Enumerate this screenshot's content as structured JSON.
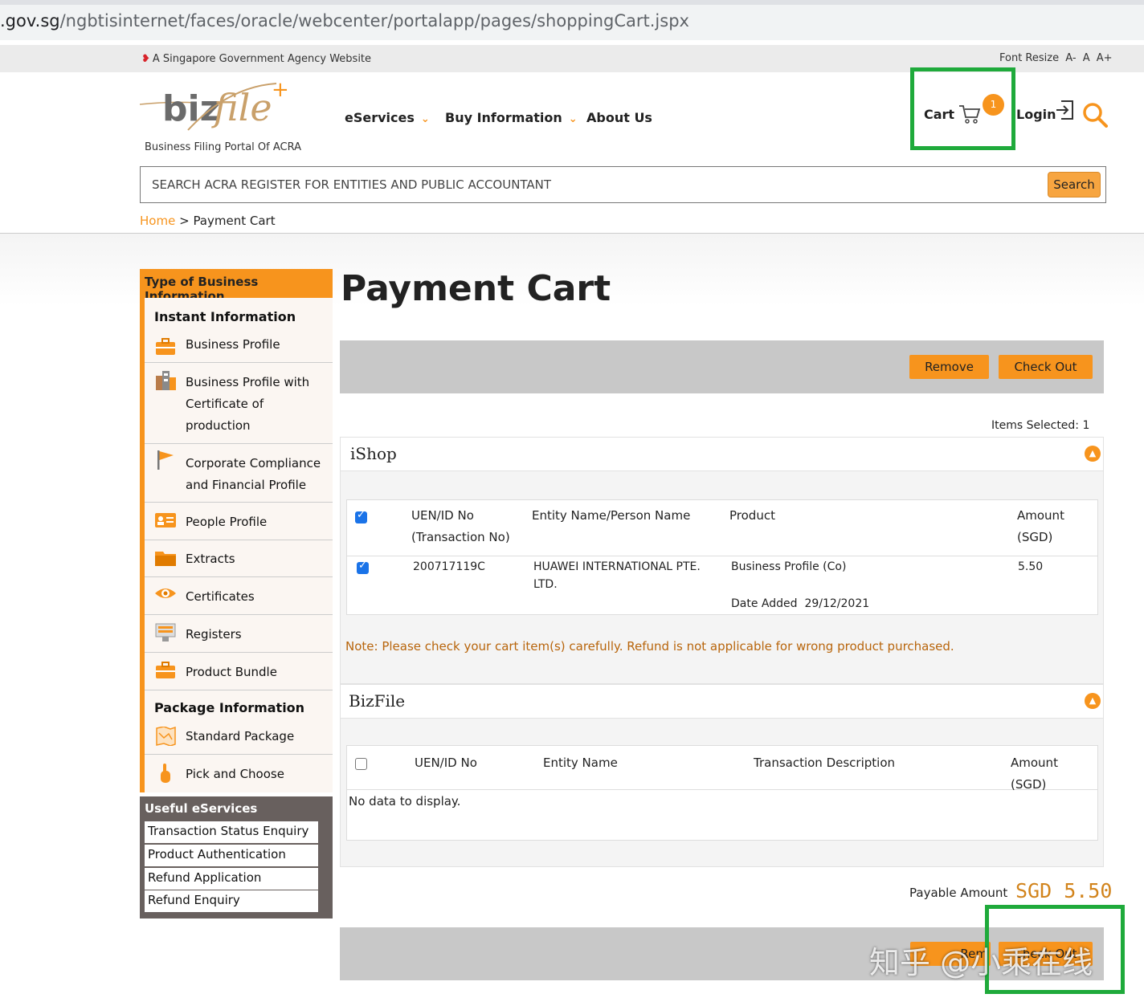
{
  "browser": {
    "url_domain": ".gov.sg",
    "url_path": "/ngbtisinternet/faces/oracle/webcenter/portalapp/pages/shoppingCart.jspx"
  },
  "gov_strip": {
    "text": "A Singapore Government Agency Website",
    "font_resize_label": "Font Resize",
    "font_sizes": [
      "A-",
      "A",
      "A+"
    ]
  },
  "header": {
    "logo_tagline": "Business Filing Portal Of ACRA",
    "nav": [
      {
        "label": "eServices",
        "dropdown": true
      },
      {
        "label": "Buy Information",
        "dropdown": true
      },
      {
        "label": "About Us",
        "dropdown": false
      }
    ],
    "cart_label": "Cart",
    "cart_count": "1",
    "login_label": "Login",
    "accent_color": "#f7941d"
  },
  "search": {
    "placeholder": "SEARCH ACRA REGISTER FOR ENTITIES AND PUBLIC ACCOUNTANT",
    "button_label": "Search"
  },
  "breadcrumb": {
    "home": "Home",
    "separator": ">",
    "current": "Payment Cart"
  },
  "sidebar": {
    "title": "Type of Business Information",
    "instant_heading": "Instant Information",
    "items": [
      {
        "label": "Business Profile",
        "icon": "briefcase-icon"
      },
      {
        "label": "Business Profile with Certificate of production",
        "icon": "building-icon"
      },
      {
        "label": "Corporate Compliance and Financial Profile",
        "icon": "flag-icon"
      },
      {
        "label": "People Profile",
        "icon": "id-card-icon"
      },
      {
        "label": "Extracts",
        "icon": "folder-icon"
      },
      {
        "label": "Certificates",
        "icon": "eye-icon"
      },
      {
        "label": "Registers",
        "icon": "register-icon"
      },
      {
        "label": "Product Bundle",
        "icon": "briefcase-icon"
      }
    ],
    "package_heading": "Package Information",
    "package_items": [
      {
        "label": "Standard Package",
        "icon": "map-icon"
      },
      {
        "label": "Pick and Choose",
        "icon": "pointer-hand-icon"
      }
    ]
  },
  "useful": {
    "title": "Useful eServices",
    "links": [
      "Transaction Status Enquiry",
      "Product Authentication",
      "Refund Application",
      "Refund Enquiry"
    ]
  },
  "main": {
    "title": "Payment Cart",
    "remove_label": "Remove",
    "checkout_label": "Check Out",
    "items_selected": "Items Selected: 1",
    "ishop": {
      "title": "iShop",
      "headers": {
        "uen": "UEN/ID No",
        "txn": "(Transaction No)",
        "entity": "Entity Name/Person Name",
        "product": "Product",
        "amount": "Amount",
        "currency": "(SGD)"
      },
      "rows": [
        {
          "uen": "200717119C",
          "entity_line1": "HUAWEI INTERNATIONAL PTE.",
          "entity_line2": "LTD.",
          "product": "Business Profile (Co)",
          "date_label": "Date Added",
          "date": "29/12/2021",
          "amount": "5.50",
          "checked": true
        }
      ]
    },
    "note": "Note: Please check your cart item(s) carefully. Refund is not applicable for wrong product purchased.",
    "bizfile": {
      "title": "BizFile",
      "headers": {
        "uen": "UEN/ID No",
        "entity": "Entity Name",
        "desc": "Transaction Description",
        "amount": "Amount (SGD)"
      },
      "empty": "No data to display."
    },
    "payable_label": "Payable Amount",
    "payable_amount": "SGD 5.50",
    "bottom_remove_fragment": "Rem",
    "bottom_checkout_fragment": "Check Out"
  },
  "watermark": "知乎 @小乘在线"
}
